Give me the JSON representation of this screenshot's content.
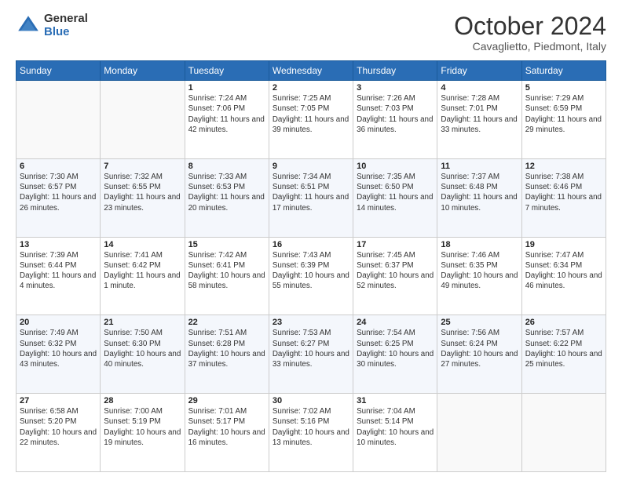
{
  "header": {
    "logo_general": "General",
    "logo_blue": "Blue",
    "month_title": "October 2024",
    "location": "Cavaglietto, Piedmont, Italy"
  },
  "weekdays": [
    "Sunday",
    "Monday",
    "Tuesday",
    "Wednesday",
    "Thursday",
    "Friday",
    "Saturday"
  ],
  "weeks": [
    [
      {
        "day": "",
        "info": ""
      },
      {
        "day": "",
        "info": ""
      },
      {
        "day": "1",
        "info": "Sunrise: 7:24 AM\nSunset: 7:06 PM\nDaylight: 11 hours and 42 minutes."
      },
      {
        "day": "2",
        "info": "Sunrise: 7:25 AM\nSunset: 7:05 PM\nDaylight: 11 hours and 39 minutes."
      },
      {
        "day": "3",
        "info": "Sunrise: 7:26 AM\nSunset: 7:03 PM\nDaylight: 11 hours and 36 minutes."
      },
      {
        "day": "4",
        "info": "Sunrise: 7:28 AM\nSunset: 7:01 PM\nDaylight: 11 hours and 33 minutes."
      },
      {
        "day": "5",
        "info": "Sunrise: 7:29 AM\nSunset: 6:59 PM\nDaylight: 11 hours and 29 minutes."
      }
    ],
    [
      {
        "day": "6",
        "info": "Sunrise: 7:30 AM\nSunset: 6:57 PM\nDaylight: 11 hours and 26 minutes."
      },
      {
        "day": "7",
        "info": "Sunrise: 7:32 AM\nSunset: 6:55 PM\nDaylight: 11 hours and 23 minutes."
      },
      {
        "day": "8",
        "info": "Sunrise: 7:33 AM\nSunset: 6:53 PM\nDaylight: 11 hours and 20 minutes."
      },
      {
        "day": "9",
        "info": "Sunrise: 7:34 AM\nSunset: 6:51 PM\nDaylight: 11 hours and 17 minutes."
      },
      {
        "day": "10",
        "info": "Sunrise: 7:35 AM\nSunset: 6:50 PM\nDaylight: 11 hours and 14 minutes."
      },
      {
        "day": "11",
        "info": "Sunrise: 7:37 AM\nSunset: 6:48 PM\nDaylight: 11 hours and 10 minutes."
      },
      {
        "day": "12",
        "info": "Sunrise: 7:38 AM\nSunset: 6:46 PM\nDaylight: 11 hours and 7 minutes."
      }
    ],
    [
      {
        "day": "13",
        "info": "Sunrise: 7:39 AM\nSunset: 6:44 PM\nDaylight: 11 hours and 4 minutes."
      },
      {
        "day": "14",
        "info": "Sunrise: 7:41 AM\nSunset: 6:42 PM\nDaylight: 11 hours and 1 minute."
      },
      {
        "day": "15",
        "info": "Sunrise: 7:42 AM\nSunset: 6:41 PM\nDaylight: 10 hours and 58 minutes."
      },
      {
        "day": "16",
        "info": "Sunrise: 7:43 AM\nSunset: 6:39 PM\nDaylight: 10 hours and 55 minutes."
      },
      {
        "day": "17",
        "info": "Sunrise: 7:45 AM\nSunset: 6:37 PM\nDaylight: 10 hours and 52 minutes."
      },
      {
        "day": "18",
        "info": "Sunrise: 7:46 AM\nSunset: 6:35 PM\nDaylight: 10 hours and 49 minutes."
      },
      {
        "day": "19",
        "info": "Sunrise: 7:47 AM\nSunset: 6:34 PM\nDaylight: 10 hours and 46 minutes."
      }
    ],
    [
      {
        "day": "20",
        "info": "Sunrise: 7:49 AM\nSunset: 6:32 PM\nDaylight: 10 hours and 43 minutes."
      },
      {
        "day": "21",
        "info": "Sunrise: 7:50 AM\nSunset: 6:30 PM\nDaylight: 10 hours and 40 minutes."
      },
      {
        "day": "22",
        "info": "Sunrise: 7:51 AM\nSunset: 6:28 PM\nDaylight: 10 hours and 37 minutes."
      },
      {
        "day": "23",
        "info": "Sunrise: 7:53 AM\nSunset: 6:27 PM\nDaylight: 10 hours and 33 minutes."
      },
      {
        "day": "24",
        "info": "Sunrise: 7:54 AM\nSunset: 6:25 PM\nDaylight: 10 hours and 30 minutes."
      },
      {
        "day": "25",
        "info": "Sunrise: 7:56 AM\nSunset: 6:24 PM\nDaylight: 10 hours and 27 minutes."
      },
      {
        "day": "26",
        "info": "Sunrise: 7:57 AM\nSunset: 6:22 PM\nDaylight: 10 hours and 25 minutes."
      }
    ],
    [
      {
        "day": "27",
        "info": "Sunrise: 6:58 AM\nSunset: 5:20 PM\nDaylight: 10 hours and 22 minutes."
      },
      {
        "day": "28",
        "info": "Sunrise: 7:00 AM\nSunset: 5:19 PM\nDaylight: 10 hours and 19 minutes."
      },
      {
        "day": "29",
        "info": "Sunrise: 7:01 AM\nSunset: 5:17 PM\nDaylight: 10 hours and 16 minutes."
      },
      {
        "day": "30",
        "info": "Sunrise: 7:02 AM\nSunset: 5:16 PM\nDaylight: 10 hours and 13 minutes."
      },
      {
        "day": "31",
        "info": "Sunrise: 7:04 AM\nSunset: 5:14 PM\nDaylight: 10 hours and 10 minutes."
      },
      {
        "day": "",
        "info": ""
      },
      {
        "day": "",
        "info": ""
      }
    ]
  ]
}
